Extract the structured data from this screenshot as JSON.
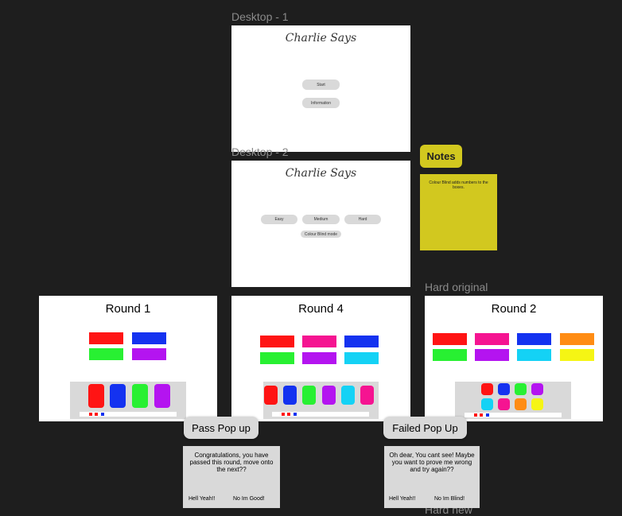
{
  "frames": {
    "desktop1": {
      "label": "Desktop - 1",
      "title": "Charlie Says",
      "start": "Start",
      "information": "Information"
    },
    "desktop2": {
      "label": "Desktop - 2",
      "title": "Charlie Says",
      "easy": "Easy",
      "medium": "Medium",
      "hard": "Hard",
      "colour_blind": "Colour Blind mode"
    },
    "hard_original_label": "Hard original",
    "hard_new_label": "Hard new",
    "round1": {
      "title": "Round 1"
    },
    "round4": {
      "title": "Round 4"
    },
    "round2": {
      "title": "Round 2"
    }
  },
  "notes": {
    "tag": "Notes",
    "text": "Colour Blind adds numbers to the boxes."
  },
  "pass_popup": {
    "tag": "Pass Pop up",
    "message": "Congratulations, you have passed this round, move onto the next??",
    "btn_yes": "Hell Yeah!!",
    "btn_no": "No Im Good!"
  },
  "failed_popup": {
    "tag": "Failed Pop Up",
    "message": "Oh dear, You cant see! Maybe you want to prove me wrong and try again??",
    "btn_yes": "Hell Yeah!!",
    "btn_no": "No Im Blind!"
  },
  "colors": {
    "red": "#ff1414",
    "blue": "#1432f0",
    "green": "#28f032",
    "purple": "#b414f0",
    "pink": "#f51491",
    "cyan": "#14d2f5",
    "orange": "#ff8c14",
    "yellow": "#f5f514",
    "note": "#d2c81f",
    "canvas": "#1e1e1e"
  }
}
